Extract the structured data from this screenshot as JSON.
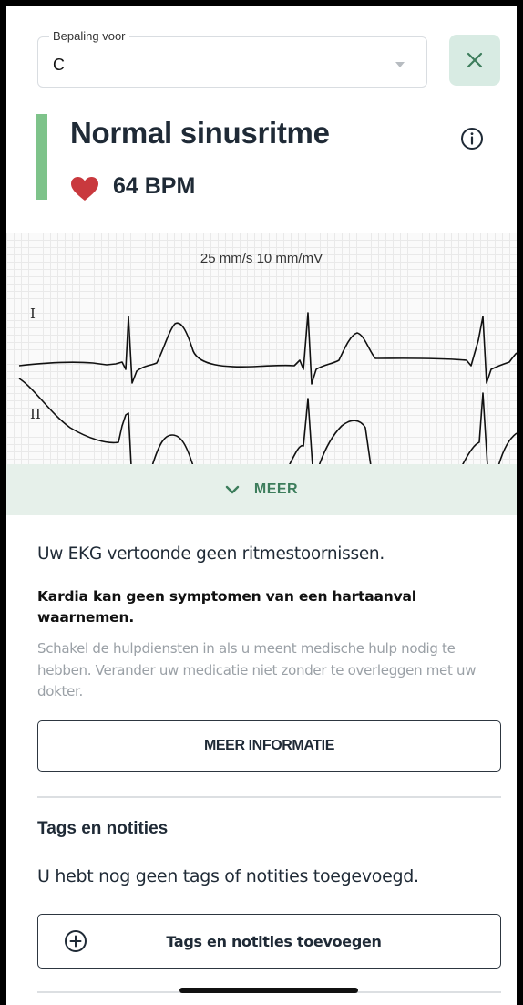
{
  "header": {
    "select_label": "Bepaling voor",
    "select_value": "C",
    "close_icon": "close-icon"
  },
  "result": {
    "title": "Normal sinusritme",
    "bpm": "64 BPM",
    "accent_color": "#7ec38a",
    "heart_color": "#c9393e"
  },
  "ecg": {
    "scale": "25 mm/s  10 mm/mV",
    "leads": [
      "I",
      "II"
    ]
  },
  "expand": {
    "label": "MEER"
  },
  "analysis": {
    "summary": "Uw EKG vertoonde geen ritmestoornissen.",
    "warning_title": "Kardia kan geen symptomen van een hartaanval waarnemen.",
    "warning_body": "Schakel de hulpdiensten in als u meent medische hulp nodig te hebben. Verander uw medicatie niet zonder te overleggen met uw dokter.",
    "more_info_button": "MEER INFORMATIE"
  },
  "tags": {
    "section_title": "Tags en notities",
    "empty_text": "U hebt nog geen tags of notities toegevoegd.",
    "add_button": "Tags en notities toevoegen"
  },
  "theme": {
    "accent_green": "#3d7d5c",
    "band_bg": "#e6f0ea"
  }
}
